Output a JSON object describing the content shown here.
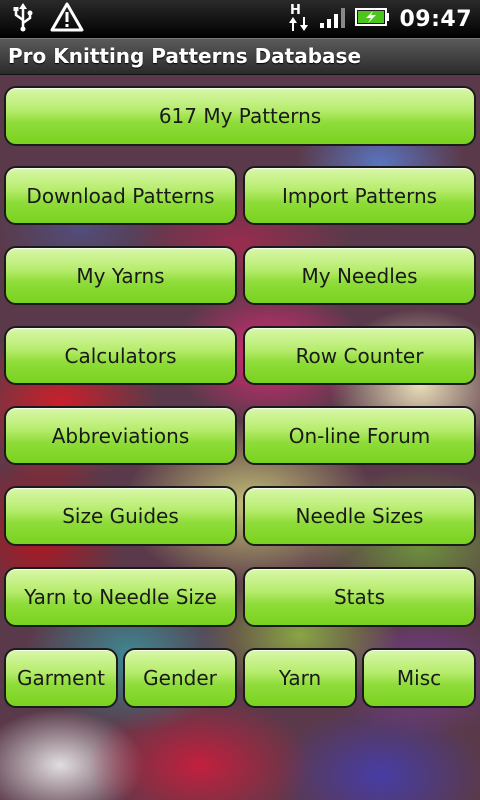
{
  "status_bar": {
    "time": "09:47",
    "left_icons": [
      "usb-icon",
      "warning-icon"
    ],
    "right_icons": [
      "data-transfer-icon",
      "signal-icon",
      "battery-charging-icon"
    ],
    "network_label": "H"
  },
  "app": {
    "title": "Pro Knitting Patterns Database"
  },
  "buttons": {
    "my_patterns": "617 My Patterns",
    "download_patterns": "Download Patterns",
    "import_patterns": "Import Patterns",
    "my_yarns": "My Yarns",
    "my_needles": "My Needles",
    "calculators": "Calculators",
    "row_counter": "Row Counter",
    "abbreviations": "Abbreviations",
    "online_forum": "On-line Forum",
    "size_guides": "Size Guides",
    "needle_sizes": "Needle Sizes",
    "yarn_to_needle_size": "Yarn to Needle Size",
    "stats": "Stats"
  },
  "categories": {
    "garment": "Garment",
    "gender": "Gender",
    "yarn": "Yarn",
    "misc": "Misc"
  },
  "colors": {
    "button_green": "#8fdc3a",
    "status_bar": "#000000",
    "title_bar": "#3a3a3a"
  }
}
